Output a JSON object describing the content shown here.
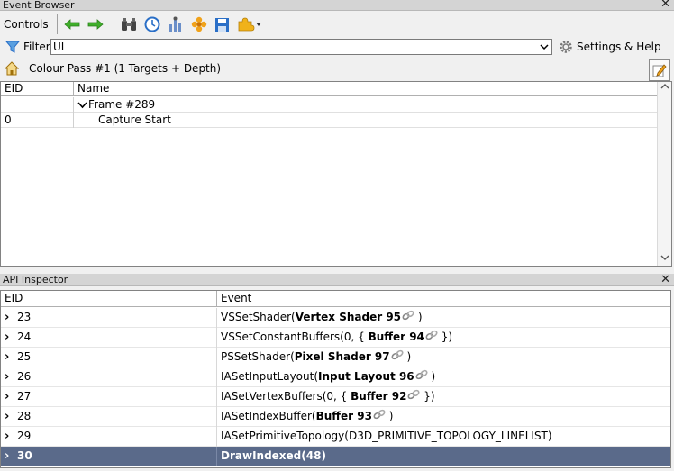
{
  "event_browser": {
    "title": "Event Browser",
    "close": "✕",
    "toolbar": {
      "controls_label": "Controls",
      "buttons": [
        "back-arrow-icon",
        "forward-arrow-icon",
        "binoculars-icon",
        "clock-icon",
        "chart-icon",
        "flower-icon",
        "save-icon",
        "puzzle-icon"
      ]
    },
    "filter": {
      "label": "Filter",
      "value": "UI",
      "settings_label": "Settings & Help"
    },
    "breadcrumb": {
      "text": "Colour Pass #1 (1 Targets + Depth)"
    },
    "tree": {
      "headers": [
        "EID",
        "Name"
      ],
      "rows": [
        {
          "eid": "",
          "name": "Frame #289",
          "expanded": true
        },
        {
          "eid": "0",
          "name": "Capture Start"
        }
      ]
    }
  },
  "api_inspector": {
    "title": "API Inspector",
    "close": "✕",
    "headers": [
      "EID",
      "Event"
    ],
    "rows": [
      {
        "eid": "23",
        "fn": "VSSetShader(",
        "arg": "Vertex Shader 95",
        "tail": " )",
        "pre": ""
      },
      {
        "eid": "24",
        "fn": "VSSetConstantBuffers(0, {",
        "arg": "Buffer 94",
        "tail": " })",
        "pre": " "
      },
      {
        "eid": "25",
        "fn": "PSSetShader(",
        "arg": "Pixel Shader 97",
        "tail": " )",
        "pre": ""
      },
      {
        "eid": "26",
        "fn": "IASetInputLayout(",
        "arg": "Input Layout 96",
        "tail": " )",
        "pre": ""
      },
      {
        "eid": "27",
        "fn": "IASetVertexBuffers(0, {",
        "arg": "Buffer 92",
        "tail": " })",
        "pre": " "
      },
      {
        "eid": "28",
        "fn": "IASetIndexBuffer(",
        "arg": "Buffer 93",
        "tail": " )",
        "pre": ""
      },
      {
        "eid": "29",
        "plain": "IASetPrimitiveTopology(D3D_PRIMITIVE_TOPOLOGY_LINELIST)"
      },
      {
        "eid": "30",
        "plain_bold": "DrawIndexed(48)",
        "selected": true
      }
    ]
  },
  "colors": {
    "panel_title_bg": "#d4d4d4",
    "selected_row_bg": "#5a6a8a",
    "arrow_green": "#3fae2a",
    "icon_blue": "#2a6fc7",
    "icon_orange": "#f0a21a"
  }
}
